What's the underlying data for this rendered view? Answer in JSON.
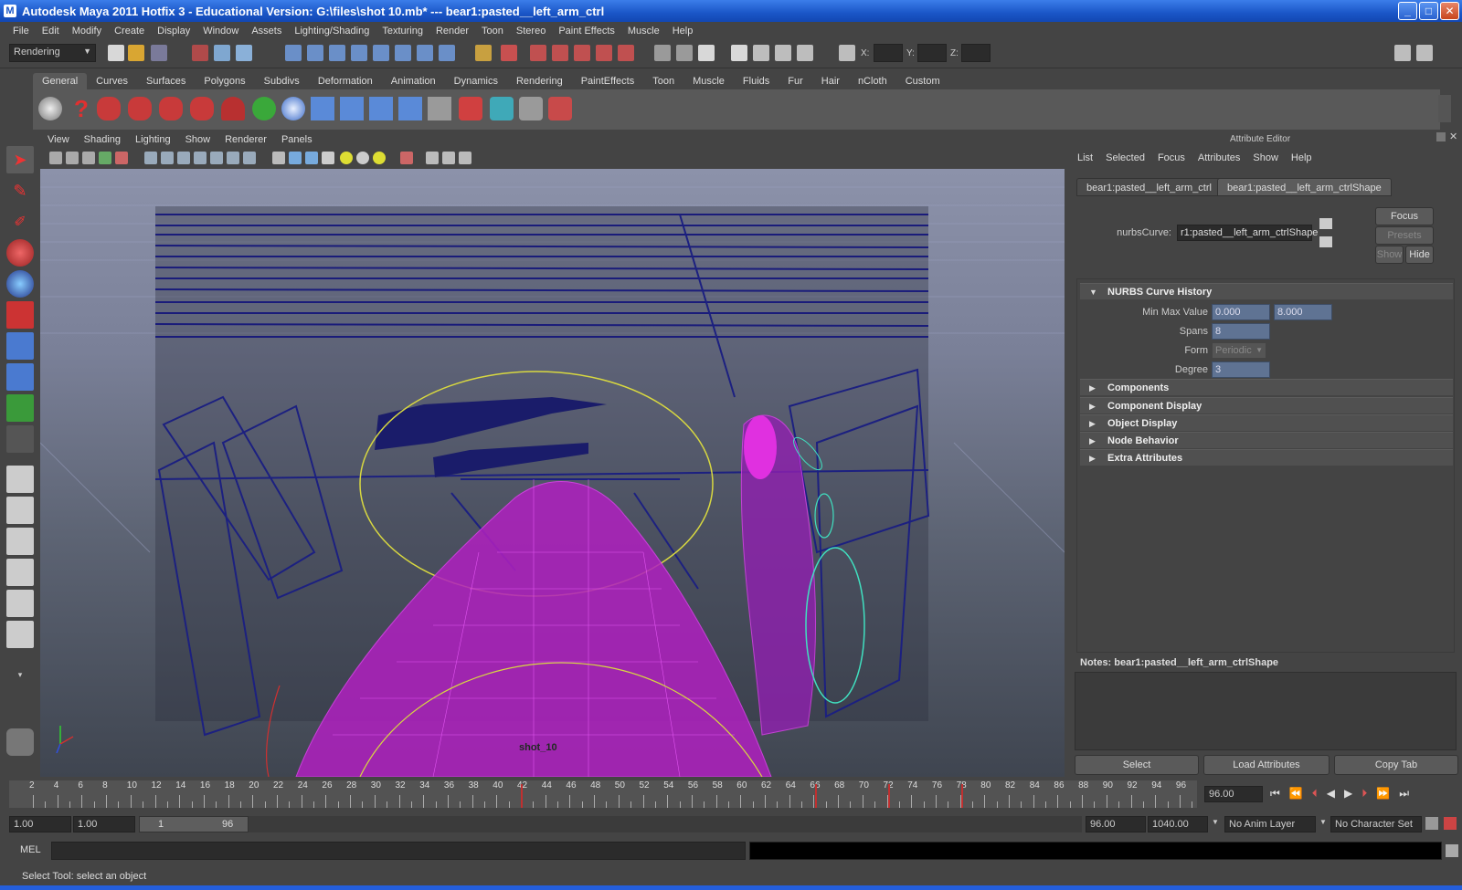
{
  "window": {
    "title": "Autodesk Maya 2011 Hotfix 3 - Educational Version: G:\\files\\shot 10.mb*   ---   bear1:pasted__left_arm_ctrl",
    "minimize": "_",
    "maximize": "□",
    "close": "✕"
  },
  "menubar": [
    "File",
    "Edit",
    "Modify",
    "Create",
    "Display",
    "Window",
    "Assets",
    "Lighting/Shading",
    "Texturing",
    "Render",
    "Toon",
    "Stereo",
    "Paint Effects",
    "Muscle",
    "Help"
  ],
  "statusline": {
    "menuset": "Rendering",
    "x_label": "X:",
    "y_label": "Y:",
    "z_label": "Z:"
  },
  "shelf": {
    "tabs": [
      "General",
      "Curves",
      "Surfaces",
      "Polygons",
      "Subdivs",
      "Deformation",
      "Animation",
      "Dynamics",
      "Rendering",
      "PaintEffects",
      "Toon",
      "Muscle",
      "Fluids",
      "Fur",
      "Hair",
      "nCloth",
      "Custom"
    ],
    "active_tab": "General"
  },
  "panel": {
    "menu": [
      "View",
      "Shading",
      "Lighting",
      "Show",
      "Renderer",
      "Panels"
    ],
    "camera_label": "shot_10"
  },
  "attribute_editor": {
    "title": "Attribute Editor",
    "menu": [
      "List",
      "Selected",
      "Focus",
      "Attributes",
      "Show",
      "Help"
    ],
    "tabs": [
      "bear1:pasted__left_arm_ctrl",
      "bear1:pasted__left_arm_ctrlShape"
    ],
    "node_type_label": "nurbsCurve:",
    "node_name": "r1:pasted__left_arm_ctrlShape",
    "focus_button": "Focus",
    "presets_button": "Presets",
    "show_button": "Show",
    "hide_button": "Hide",
    "section_history": "NURBS Curve History",
    "min_max_label": "Min Max Value",
    "min_value": "0.000",
    "max_value": "8.000",
    "spans_label": "Spans",
    "spans_value": "8",
    "form_label": "Form",
    "form_value": "Periodic",
    "degree_label": "Degree",
    "degree_value": "3",
    "sections": [
      "Components",
      "Component Display",
      "Object Display",
      "Node Behavior",
      "Extra Attributes"
    ],
    "notes": "Notes:  bear1:pasted__left_arm_ctrlShape",
    "select_button": "Select",
    "load_button": "Load Attributes",
    "copy_button": "Copy Tab"
  },
  "timeline": {
    "ticks": [
      "2",
      "4",
      "6",
      "8",
      "10",
      "12",
      "14",
      "16",
      "18",
      "20",
      "22",
      "24",
      "26",
      "28",
      "30",
      "32",
      "34",
      "36",
      "38",
      "40",
      "42",
      "44",
      "46",
      "48",
      "50",
      "52",
      "54",
      "56",
      "58",
      "60",
      "62",
      "64",
      "66",
      "68",
      "70",
      "72",
      "74",
      "76",
      "78",
      "80",
      "82",
      "84",
      "86",
      "88",
      "90",
      "92",
      "94",
      "96"
    ],
    "current_frame": "96.00",
    "range_start": "1.00",
    "range_start2": "1.00",
    "slider_start": "1",
    "slider_end": "96",
    "range_end": "96.00",
    "range_end2": "1040.00",
    "anim_layer": "No Anim Layer",
    "character_set": "No Character Set"
  },
  "command_line": {
    "label": "MEL"
  },
  "help_line": "Select Tool: select an object"
}
